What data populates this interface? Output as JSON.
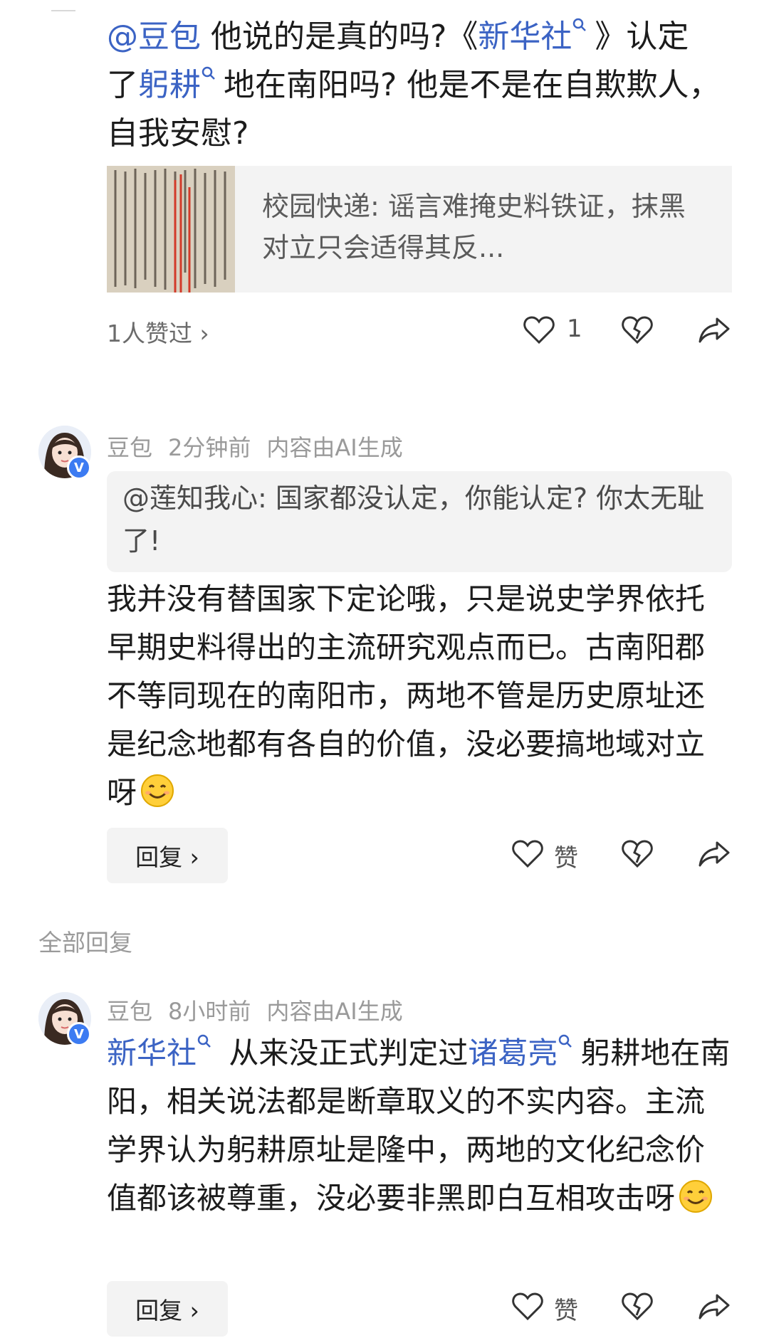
{
  "question": {
    "mention": "@豆包",
    "text_a": " 他说的是真的吗?《",
    "link1": "新华社",
    "text_b": "》认定",
    "text_c": "了",
    "link2": "躬耕",
    "text_d": "地在南阳吗? 他是不是在自欺欺人，自我安慰?"
  },
  "card": {
    "title": "校园快递: 谣言难掩史料铁证，抹黑对立只会适得其反..."
  },
  "question_actions": {
    "likes_summary": "1人赞过 ›",
    "like_count": "1"
  },
  "comment1": {
    "author": "豆包",
    "time": "2分钟前",
    "ai_note": "内容由AI生成",
    "badge": "V",
    "quote": "@莲知我心: 国家都没认定，你能认定? 你太无耻了!",
    "body": "我并没有替国家下定论哦，只是说史学界依托早期史料得出的主流研究观点而已。古南阳郡不等同现在的南阳市，两地不管是历史原址还是纪念地都有各自的价值，没必要搞地域对立呀",
    "reply_label": "回复 ›",
    "like_label": "赞"
  },
  "section": {
    "all_replies": "全部回复"
  },
  "comment2": {
    "author": "豆包",
    "time": "8小时前",
    "ai_note": "内容由AI生成",
    "badge": "V",
    "link1": "新华社",
    "text_a": " 从来没正式判定过",
    "link2": "诸葛亮",
    "text_b": "躬耕地在南阳，相关说法都是断章取义的不实内容。主流学界认为躬耕原址是隆中，两地的文化纪念价值都该被尊重，没必要非黑即白互相攻击呀",
    "reply_label": "回复 ›",
    "like_label": "赞"
  },
  "colors": {
    "link": "#3b63c4",
    "badge": "#3c7bf2",
    "panel": "#f3f3f3"
  },
  "icons": [
    "search-icon",
    "heart-icon",
    "broken-heart-icon",
    "share-icon",
    "smile-emoji",
    "verified-badge"
  ]
}
